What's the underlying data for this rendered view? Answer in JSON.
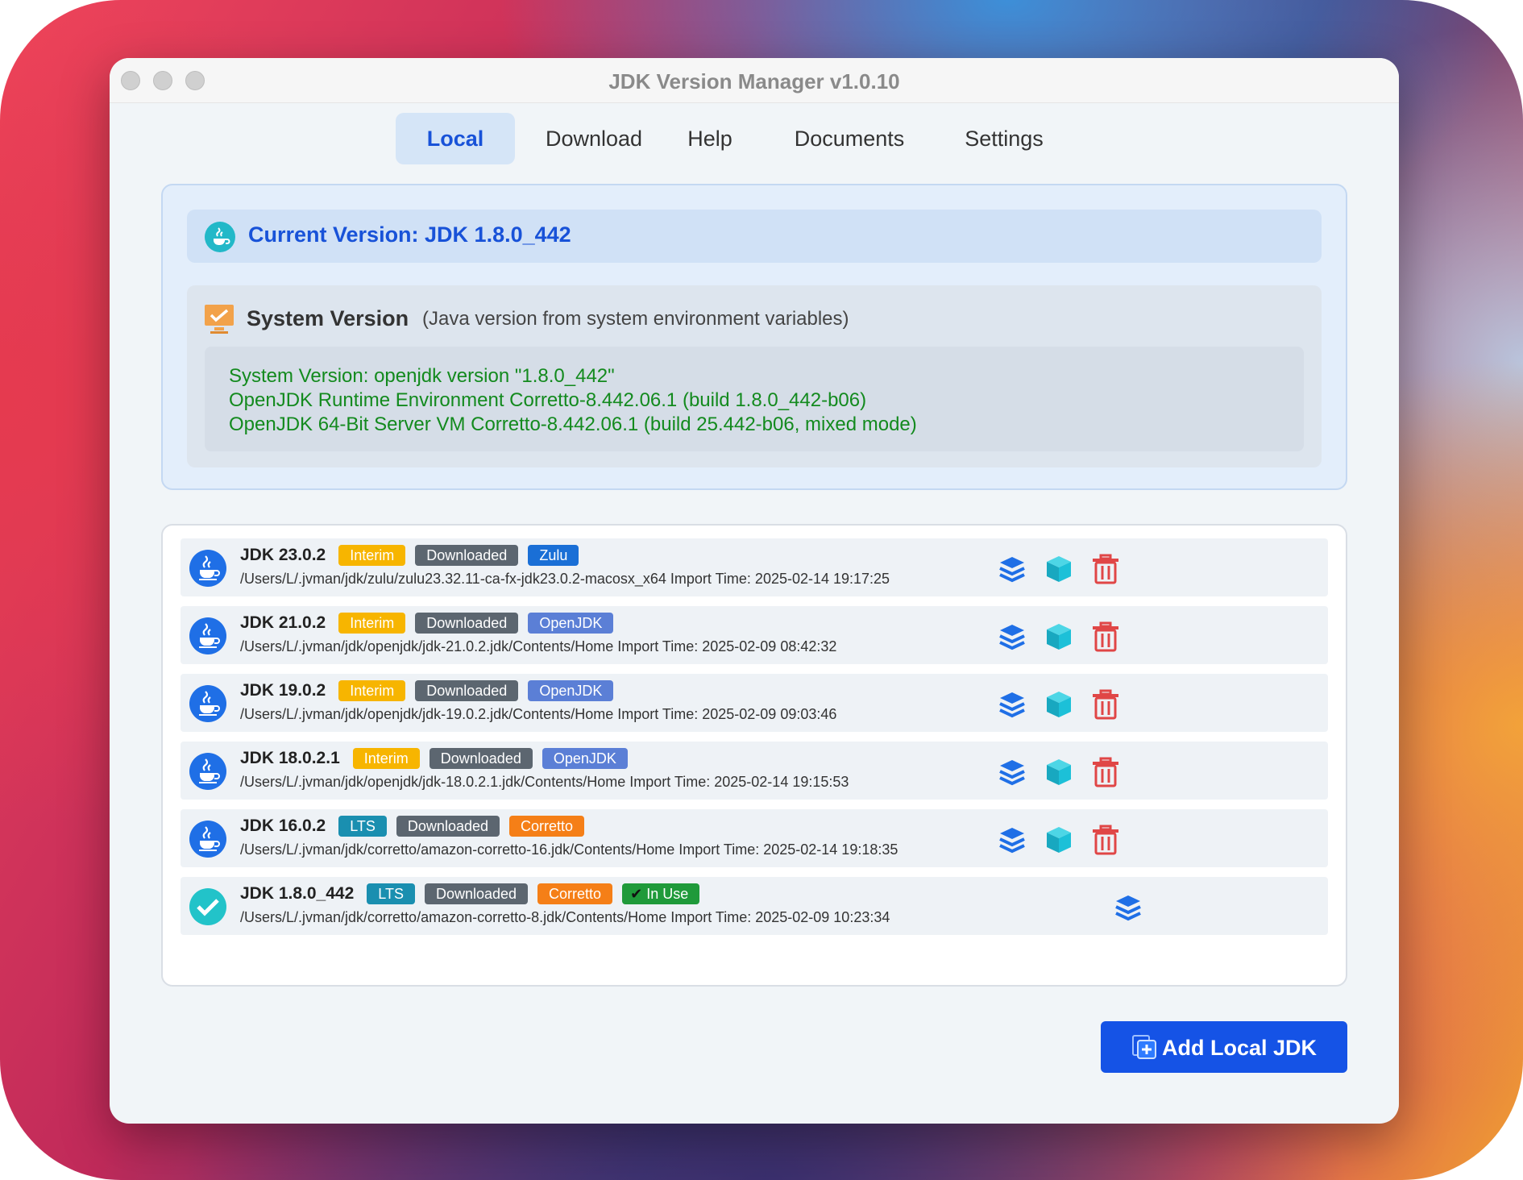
{
  "window": {
    "title": "JDK Version Manager v1.0.10"
  },
  "tabs": [
    {
      "label": "Local",
      "active": true
    },
    {
      "label": "Download",
      "active": false
    },
    {
      "label": "Help",
      "active": false
    },
    {
      "label": "Documents",
      "active": false
    },
    {
      "label": "Settings",
      "active": false
    }
  ],
  "current": {
    "text": "Current Version: JDK 1.8.0_442",
    "icon": "java-cup-icon"
  },
  "system": {
    "title": "System Version",
    "hint": "(Java version from system environment variables)",
    "lines": [
      "System Version: openjdk version \"1.8.0_442\"",
      "OpenJDK Runtime Environment Corretto-8.442.06.1 (build 1.8.0_442-b06)",
      "OpenJDK 64-Bit Server VM Corretto-8.442.06.1 (build 25.442-b06, mixed mode)"
    ]
  },
  "jdks": [
    {
      "name": "JDK 23.0.2",
      "type": "Interim",
      "status": "Downloaded",
      "vendor": "Zulu",
      "path": "/Users/L/.jvman/jdk/zulu/zulu23.32.11-ca-fx-jdk23.0.2-macosx_x64 Import Time: 2025-02-14 19:17:25"
    },
    {
      "name": "JDK 21.0.2",
      "type": "Interim",
      "status": "Downloaded",
      "vendor": "OpenJDK",
      "path": "/Users/L/.jvman/jdk/openjdk/jdk-21.0.2.jdk/Contents/Home Import Time: 2025-02-09 08:42:32"
    },
    {
      "name": "JDK 19.0.2",
      "type": "Interim",
      "status": "Downloaded",
      "vendor": "OpenJDK",
      "path": "/Users/L/.jvman/jdk/openjdk/jdk-19.0.2.jdk/Contents/Home Import Time: 2025-02-09 09:03:46"
    },
    {
      "name": "JDK 18.0.2.1",
      "type": "Interim",
      "status": "Downloaded",
      "vendor": "OpenJDK",
      "path": "/Users/L/.jvman/jdk/openjdk/jdk-18.0.2.1.jdk/Contents/Home Import Time: 2025-02-14 19:15:53"
    },
    {
      "name": "JDK 16.0.2",
      "type": "LTS",
      "status": "Downloaded",
      "vendor": "Corretto",
      "path": "/Users/L/.jvman/jdk/corretto/amazon-corretto-16.jdk/Contents/Home Import Time: 2025-02-14 19:18:35"
    },
    {
      "name": "JDK 1.8.0_442",
      "type": "LTS",
      "status": "Downloaded",
      "vendor": "Corretto",
      "in_use": "In Use",
      "path": "/Users/L/.jvman/jdk/corretto/amazon-corretto-8.jdk/Contents/Home Import Time: 2025-02-09 10:23:34"
    }
  ],
  "badge_colors": {
    "Interim": "#f7b500",
    "LTS": "#1a8fb0",
    "Downloaded": "#5c6670",
    "Zulu": "#1a6fd6",
    "OpenJDK": "#5b7fd6",
    "Corretto": "#f57f17",
    "In Use": "#1f9a3a"
  },
  "icons": {
    "layers": "layers-icon",
    "cube": "cube-icon",
    "trash": "trash-icon",
    "check": "check-circle-icon"
  },
  "add_button": {
    "label": "Add Local JDK"
  }
}
